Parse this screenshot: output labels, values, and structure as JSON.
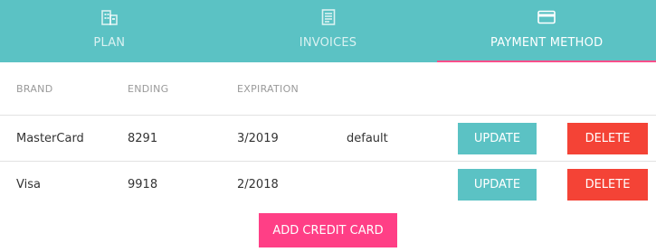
{
  "tabs": [
    {
      "label": "PLAN",
      "icon": "building-icon",
      "active": false
    },
    {
      "label": "INVOICES",
      "icon": "invoice-icon",
      "active": false
    },
    {
      "label": "PAYMENT METHOD",
      "icon": "credit-card-icon",
      "active": true
    }
  ],
  "table": {
    "headers": {
      "brand": "BRAND",
      "ending": "ENDING",
      "expiration": "EXPIRATION"
    },
    "rows": [
      {
        "brand": "MasterCard",
        "ending": "8291",
        "expiration": "3/2019",
        "status": "default",
        "update_label": "UPDATE",
        "delete_label": "DELETE"
      },
      {
        "brand": "Visa",
        "ending": "9918",
        "expiration": "2/2018",
        "status": "",
        "update_label": "UPDATE",
        "delete_label": "DELETE"
      }
    ]
  },
  "add_card_label": "ADD CREDIT CARD",
  "colors": {
    "accent": "#5bc2c4",
    "danger": "#f44336",
    "primary_action": "#ff3f86",
    "active_underline": "#ff4f8b"
  }
}
